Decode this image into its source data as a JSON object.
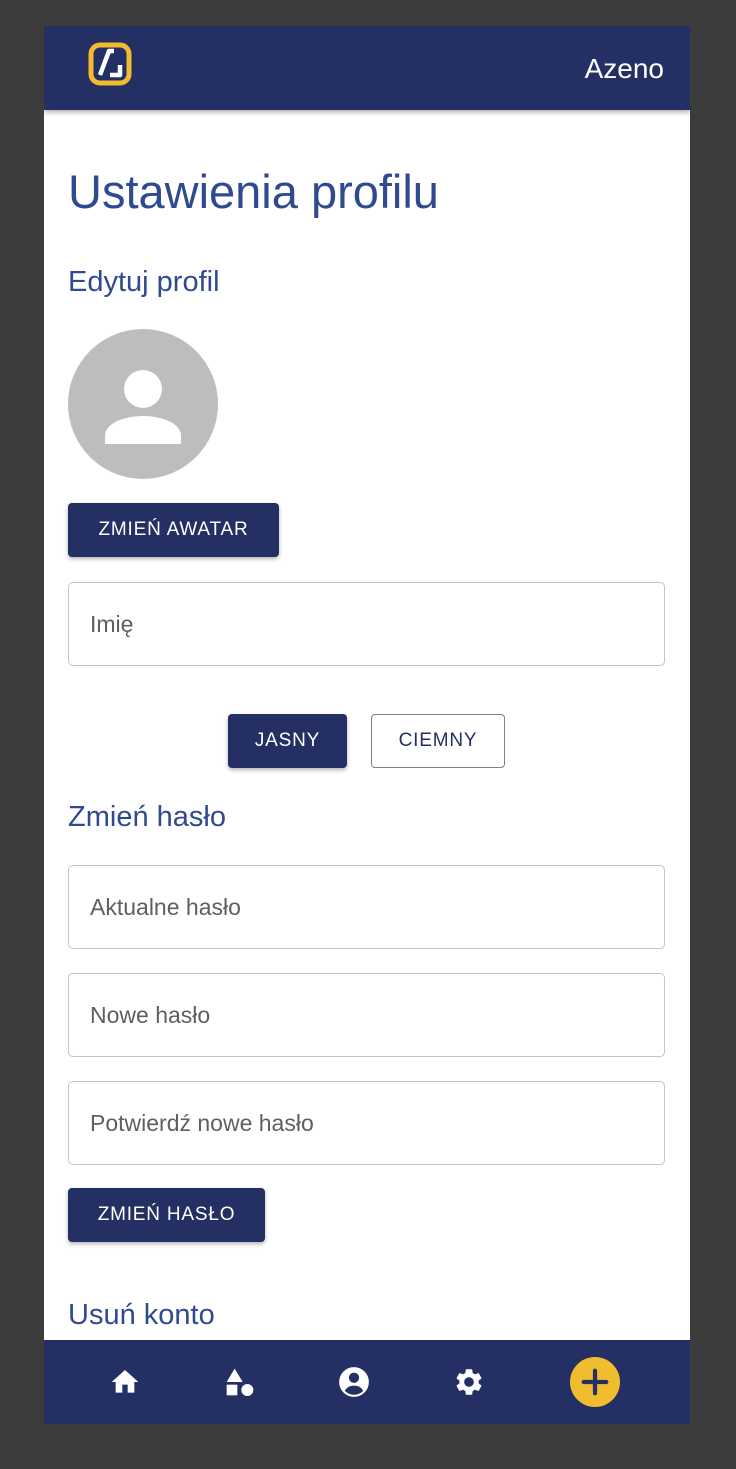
{
  "header": {
    "brand": "Azeno",
    "logo_icon": "azeno-logo-icon"
  },
  "page": {
    "title": "Ustawienia profilu"
  },
  "edit_profile": {
    "heading": "Edytuj profil",
    "avatar_icon": "person-icon",
    "change_avatar_label": "ZMIEŃ AWATAR",
    "name_placeholder": "Imię",
    "name_value": ""
  },
  "theme": {
    "light_label": "JASNY",
    "dark_label": "CIEMNY",
    "selected": "JASNY"
  },
  "change_password": {
    "heading": "Zmień hasło",
    "current_placeholder": "Aktualne hasło",
    "new_placeholder": "Nowe hasło",
    "confirm_placeholder": "Potwierdź nowe hasło",
    "submit_label": "ZMIEŃ HASŁO"
  },
  "delete_account": {
    "heading": "Usuń konto"
  },
  "bottom_nav": {
    "items": [
      {
        "icon": "home-icon"
      },
      {
        "icon": "shapes-icon"
      },
      {
        "icon": "account-circle-icon"
      },
      {
        "icon": "gear-icon"
      },
      {
        "icon": "plus-icon"
      }
    ]
  },
  "colors": {
    "primary": "#243063",
    "heading": "#2f4a91",
    "accent": "#f2bc2f",
    "avatar_bg": "#bdbdbd"
  }
}
